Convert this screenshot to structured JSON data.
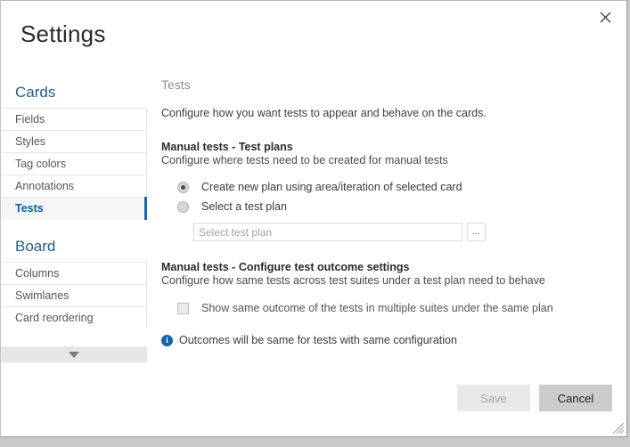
{
  "window": {
    "title": "Settings",
    "close_label": "✕",
    "close_icon": "close-icon",
    "resize_grip_icon": "resize-grip-icon"
  },
  "sidebar": {
    "groups": [
      {
        "title": "Cards",
        "items": [
          {
            "label": "Fields",
            "selected": false
          },
          {
            "label": "Styles",
            "selected": false
          },
          {
            "label": "Tag colors",
            "selected": false
          },
          {
            "label": "Annotations",
            "selected": false
          },
          {
            "label": "Tests",
            "selected": true
          }
        ]
      },
      {
        "title": "Board",
        "items": [
          {
            "label": "Columns",
            "selected": false
          },
          {
            "label": "Swimlanes",
            "selected": false
          },
          {
            "label": "Card reordering",
            "selected": false
          }
        ]
      }
    ],
    "scroll_down_icon": "chevron-down-icon"
  },
  "main": {
    "section_title": "Tests",
    "intro": "Configure how you want tests to appear and behave on the cards.",
    "test_plans": {
      "heading": "Manual tests - Test plans",
      "description": "Configure where tests need to be created for manual tests",
      "options": [
        {
          "label": "Create new plan using area/iteration of selected card",
          "selected": true
        },
        {
          "label": "Select a test plan",
          "selected": false
        }
      ],
      "plan_input_value": "",
      "plan_input_placeholder": "Select test plan",
      "browse_label": "..."
    },
    "outcome_settings": {
      "heading": "Manual tests - Configure test outcome settings",
      "description": "Configure how same tests across test suites under a test plan need to behave",
      "checkbox_label": "Show same outcome of the tests in multiple suites under the same plan",
      "checkbox_checked": false,
      "info_icon": "info-icon",
      "info_text": "Outcomes will be same for tests with same configuration"
    }
  },
  "footer": {
    "save_label": "Save",
    "cancel_label": "Cancel"
  },
  "colors": {
    "accent_blue": "#1467b3",
    "group_title_blue": "#21608f",
    "selected_text_blue": "#0a5ba8",
    "info_blue": "#1864ab",
    "cancel_bg": "#cccccc",
    "save_bg": "#e9e9e9"
  }
}
